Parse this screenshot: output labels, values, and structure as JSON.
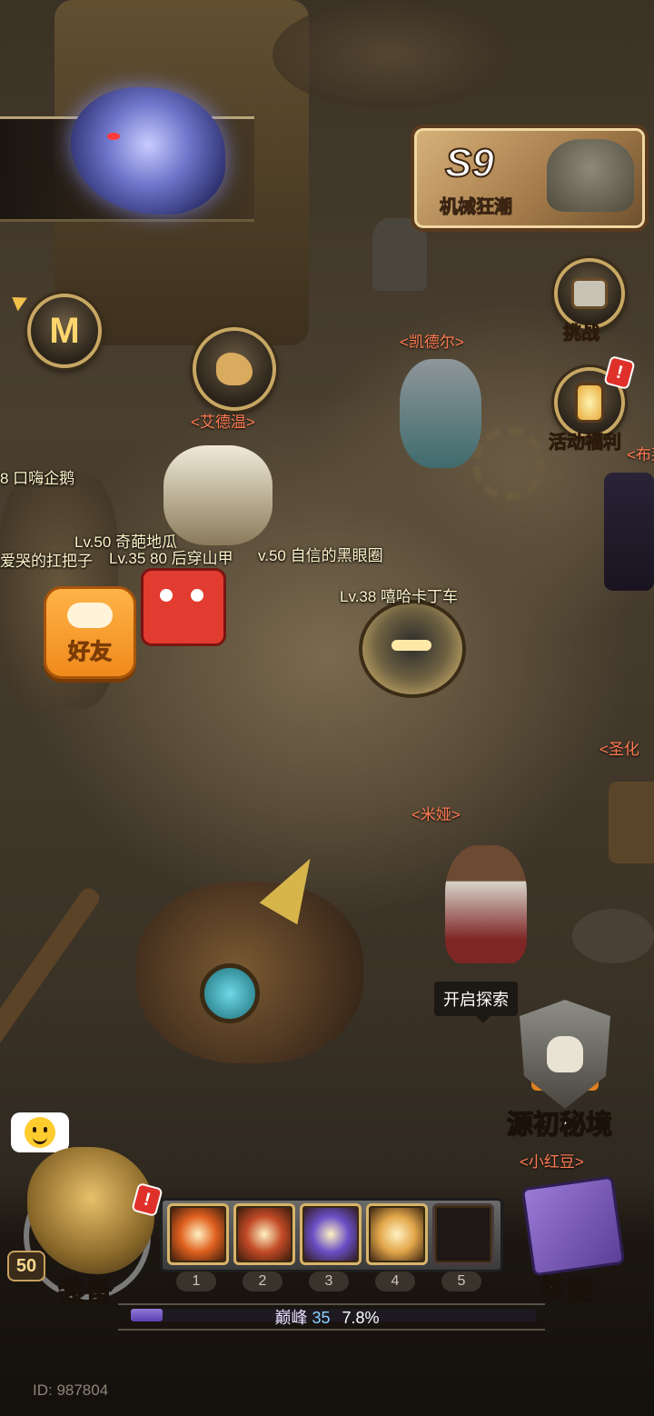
{
  "season": {
    "number": "S9",
    "name": "机械狂潮"
  },
  "side_buttons": {
    "challenge": {
      "label": "挑战",
      "badge": "!"
    },
    "events": {
      "label": "活动福利",
      "badge": "!"
    }
  },
  "npc_names": {
    "kaideer": "<凯德尔>",
    "aidewen": "<艾德温>",
    "mia": "<米娅>",
    "xiaohongdou": "<小红豆>",
    "bu": "<布莱",
    "shenghua": "<圣化"
  },
  "player_names": {
    "left_penguin": "8 口嗨企鹅",
    "sweet_potato": "Lv.50 奇葩地瓜",
    "crybaby": "爱哭的扛把子",
    "pangolin": "Lv.35 80 后穿山甲",
    "black_eye": "v.50 自信的黑眼圈",
    "kading": "Lv.38 嘻哈卡丁车"
  },
  "friend_button": {
    "label": "好友"
  },
  "explore": {
    "tooltip": "开启探索",
    "label": "源初秘境"
  },
  "equipment": {
    "label": "装备",
    "level": "50",
    "badge": "!"
  },
  "skills": {
    "label": "技能",
    "slots": [
      {
        "num": "1",
        "color": "#e0601f",
        "icon": "fire-slash-icon"
      },
      {
        "num": "2",
        "color": "#c24a26",
        "icon": "flame-burst-icon"
      },
      {
        "num": "3",
        "color": "#6a4fc6",
        "icon": "void-orb-icon"
      },
      {
        "num": "4",
        "color": "#e2a64a",
        "icon": "whirlwind-icon"
      },
      {
        "num": "5",
        "color": "",
        "icon": ""
      }
    ]
  },
  "progress": {
    "label": "巅峰",
    "level": "35",
    "percent_text": "7.8%",
    "fraction": 0.078
  },
  "player_id": "ID: 987804",
  "colors": {
    "npc_name": "#ff7b52",
    "accent_gold": "#c7a763",
    "xp_bar": "#7a5fd0"
  }
}
